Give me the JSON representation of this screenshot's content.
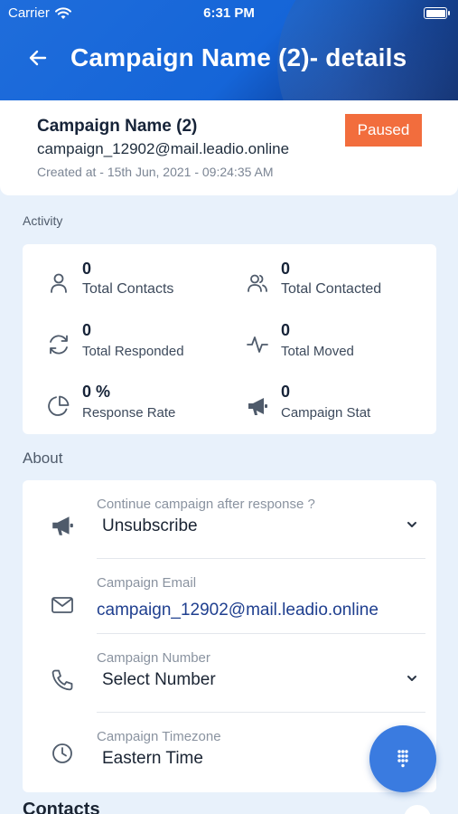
{
  "status_bar": {
    "carrier": "Carrier",
    "time": "6:31 PM"
  },
  "header": {
    "title": "Campaign Name (2)- details"
  },
  "campaign": {
    "name": "Campaign Name (2)",
    "email": "campaign_12902@mail.leadio.online",
    "created": "Created at - 15th Jun, 2021 - 09:24:35 AM",
    "status": "Paused",
    "status_color": "#f26d3d"
  },
  "activity": {
    "label": "Activity",
    "stats": [
      {
        "icon": "user-icon",
        "value": "0",
        "label": "Total Contacts"
      },
      {
        "icon": "users-icon",
        "value": "0",
        "label": "Total Contacted"
      },
      {
        "icon": "refresh-icon",
        "value": "0",
        "label": "Total Responded"
      },
      {
        "icon": "activity-pulse-icon",
        "value": "0",
        "label": "Total Moved"
      },
      {
        "icon": "pie-chart-icon",
        "value": "0 %",
        "label": "Response Rate"
      },
      {
        "icon": "megaphone-icon",
        "value": "0",
        "label": "Campaign Stat"
      }
    ]
  },
  "about": {
    "label": "About",
    "fields": [
      {
        "icon": "megaphone-icon",
        "label": "Continue campaign after response ?",
        "value": "Unsubscribe",
        "has_dropdown": true
      },
      {
        "icon": "mail-icon",
        "label": "Campaign Email",
        "value": "campaign_12902@mail.leadio.online",
        "has_dropdown": false
      },
      {
        "icon": "phone-icon",
        "label": "Campaign Number",
        "value": "Select Number",
        "has_dropdown": true
      },
      {
        "icon": "clock-icon",
        "label": "Campaign Timezone",
        "value": "Eastern Time",
        "has_dropdown": false
      }
    ]
  },
  "contacts": {
    "label": "Contacts"
  },
  "fab": {
    "icon": "dialpad-icon"
  },
  "colors": {
    "header_blue": "#1565d8",
    "fab_blue": "#3a7be0",
    "page_bg": "#e8f1fb"
  }
}
